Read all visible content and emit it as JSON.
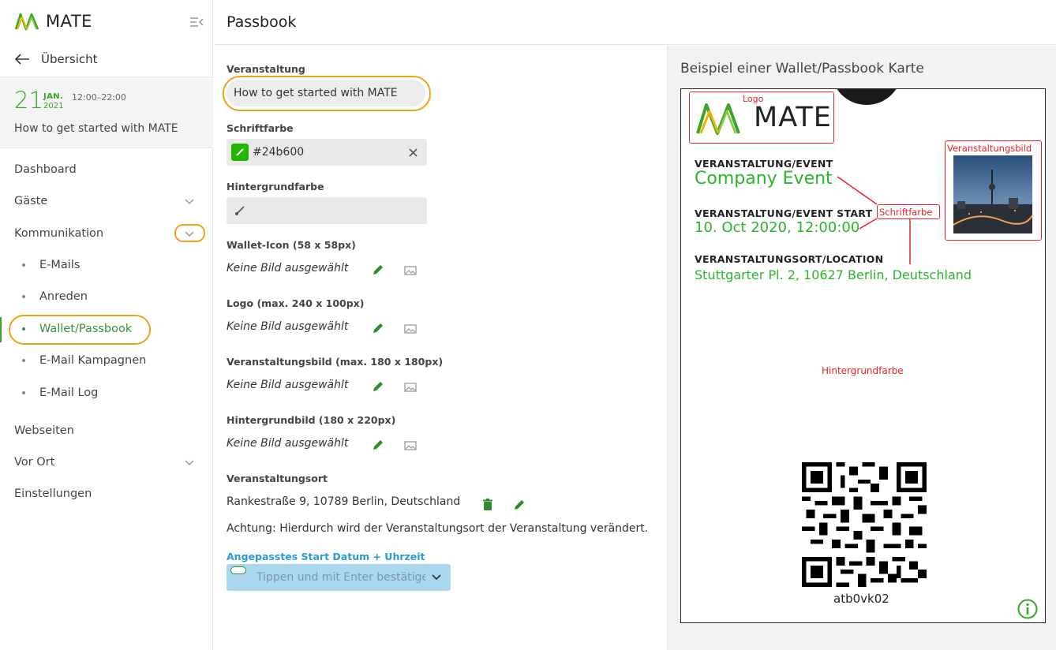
{
  "app": {
    "brand": "MATE"
  },
  "sidebar": {
    "back_label": "Übersicht",
    "event": {
      "day": "21",
      "month": "JAN.",
      "year": "2021",
      "time": "12:00–22:00",
      "title": "How to get started with MATE"
    },
    "items": [
      {
        "label": "Dashboard"
      },
      {
        "label": "Gäste"
      },
      {
        "label": "Kommunikation"
      },
      {
        "label": "Webseiten"
      },
      {
        "label": "Vor Ort"
      },
      {
        "label": "Einstellungen"
      }
    ],
    "sub_items": [
      {
        "label": "E-Mails"
      },
      {
        "label": "Anreden"
      },
      {
        "label": "Wallet/Passbook",
        "active": true
      },
      {
        "label": "E-Mail Kampagnen"
      },
      {
        "label": "E-Mail Log"
      }
    ]
  },
  "header": {
    "title": "Passbook"
  },
  "form": {
    "event_label": "Veranstaltung",
    "event_value": "How to get started with MATE",
    "font_color_label": "Schriftfarbe",
    "font_color_value": "#24b600",
    "bg_color_label": "Hintergrundfarbe",
    "bg_color_value": "",
    "wallet_icon_label": "Wallet-Icon (58 x 58px)",
    "logo_label": "Logo (max. 240 x 100px)",
    "event_image_label": "Veranstaltungsbild (max. 180 x 180px)",
    "bg_image_label": "Hintergrundbild (180 x 220px)",
    "no_image_text": "Keine Bild ausgewählt",
    "location_label": "Veranstaltungsort",
    "location_value": "Rankestraße 9, 10789 Berlin, Deutschland",
    "location_note": "Achtung: Hierdurch wird der Veranstaltungsort der Veranstaltung verändert.",
    "custom_start_label": "Angepasstes Start Datum + Uhrzeit",
    "custom_start_placeholder": "Tippen und mit Enter bestätigen"
  },
  "preview": {
    "title": "Beispiel einer Wallet/Passbook Karte",
    "annotations": {
      "logo": "Logo",
      "event_image": "Veranstaltungsbild",
      "font_color": "Schriftfarbe",
      "bg_color": "Hintergrundfarbe"
    },
    "pass": {
      "brand": "MATE",
      "event_label": "VERANSTALTUNG/EVENT",
      "event_value": "Company Event",
      "start_label": "VERANSTALTUNG/EVENT START",
      "start_value": "10. Oct 2020, 12:00:00",
      "location_label": "VERANSTALTUNGSORT/LOCATION",
      "location_value": "Stuttgarter Pl. 2, 10627 Berlin, Deutschland",
      "qr_caption": "atb0vk02"
    }
  },
  "colors": {
    "accent_green": "#3aa52b",
    "highlight_orange": "#f0a21a",
    "annotation_red": "#e8202a",
    "pass_text_green": "#2bb52b",
    "info_blue": "#2a9bd6"
  }
}
